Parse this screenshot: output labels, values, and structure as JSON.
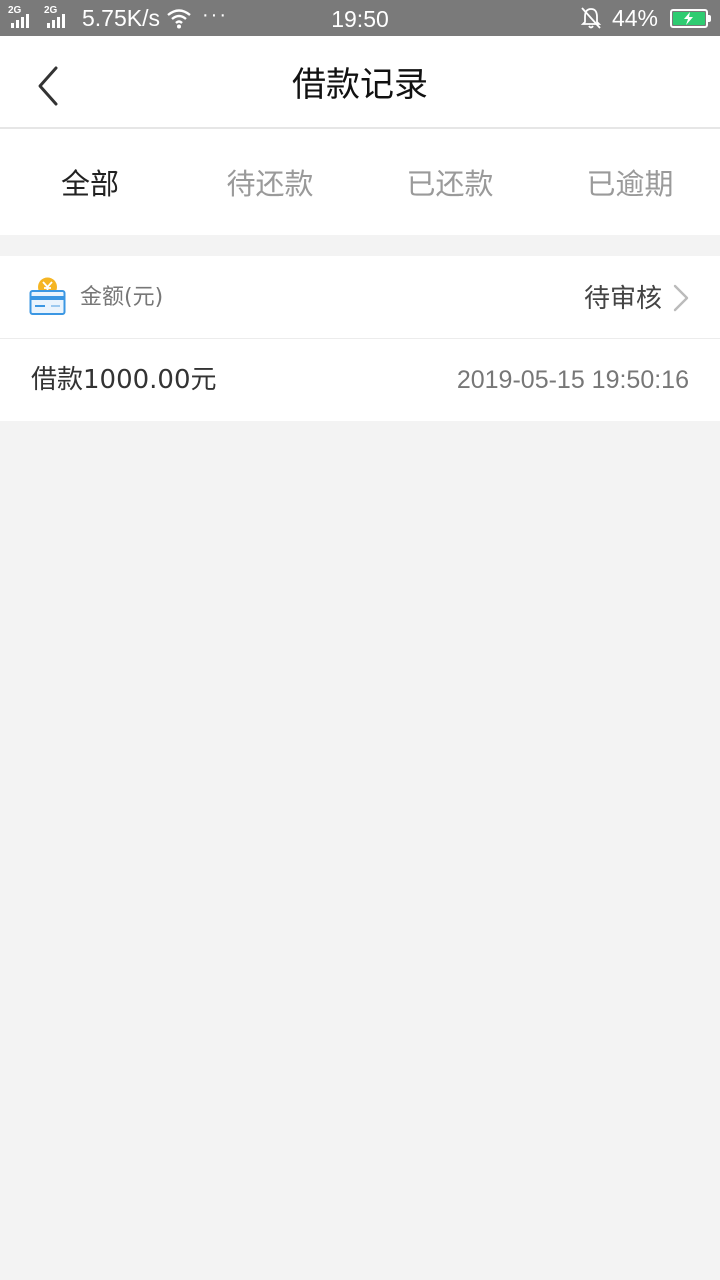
{
  "status_bar": {
    "sim1_tag": "2G",
    "sim2_tag": "2G",
    "net_speed": "5.75K/s",
    "more_indicator": "···",
    "time": "19:50",
    "battery_percent": "44%",
    "battery_level": 0.44,
    "battery_color": "#2ecc71",
    "icons": [
      "signal-icon",
      "wifi-icon",
      "bell-muted-icon",
      "battery-charging-icon"
    ]
  },
  "header": {
    "title": "借款记录"
  },
  "tabs": [
    {
      "label": "全部",
      "active": true
    },
    {
      "label": "待还款",
      "active": false
    },
    {
      "label": "已还款",
      "active": false
    },
    {
      "label": "已逾期",
      "active": false
    }
  ],
  "record": {
    "amount_label": "金额(元)",
    "status": "待审核",
    "amount_text": "借款1000.00元",
    "datetime": "2019-05-15 19:50:16",
    "icon": "coin-card-icon"
  },
  "colors": {
    "status_bar_bg": "#7a7a7a",
    "page_bg": "#f3f3f3",
    "tab_active": "#222222",
    "tab_inactive": "#9a9a9a",
    "icon_blue": "#3b97e3",
    "icon_coin": "#f5b523"
  }
}
